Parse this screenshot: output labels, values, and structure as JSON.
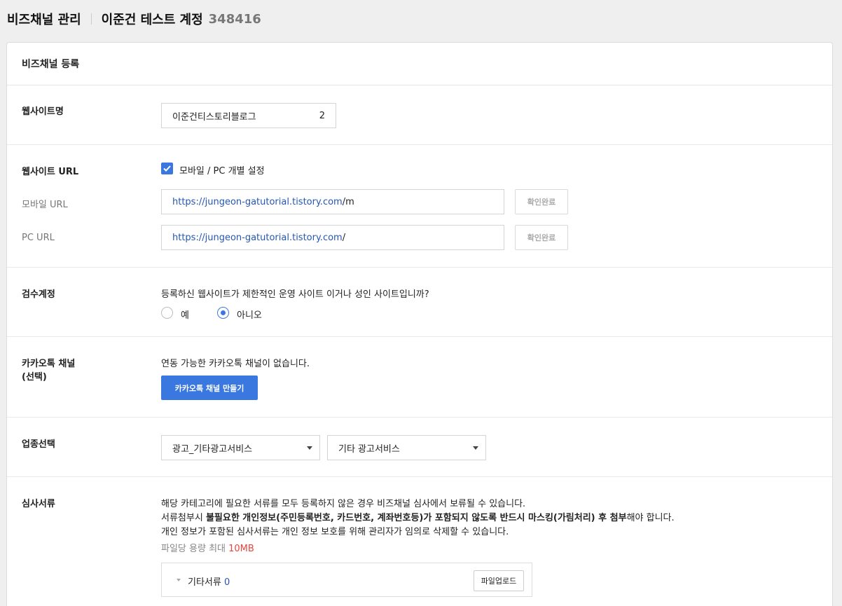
{
  "header": {
    "section_title": "비즈채널 관리",
    "account_name": "이준건 테스트 계정",
    "account_id": "348416"
  },
  "panel": {
    "title": "비즈채널 등록"
  },
  "website_name": {
    "label": "웹사이트명",
    "value": "이준건티스토리블로그",
    "char_count": "2"
  },
  "website_url": {
    "label": "웹사이트 URL",
    "checkbox_label": "모바일 / PC 개별 설정",
    "checkbox_checked": true,
    "mobile": {
      "label": "모바일 URL",
      "url_base": "https://jungeon-gatutorial.tistory.com",
      "url_path": "/m",
      "button": "확인완료"
    },
    "pc": {
      "label": "PC URL",
      "url_base": "https://jungeon-gatutorial.tistory.com",
      "url_path": "/",
      "button": "확인완료"
    }
  },
  "review_account": {
    "label": "검수계정",
    "question": "등록하신 웹사이트가 제한적인 운영 사이트 이거나 성인 사이트입니까?",
    "options": [
      "예",
      "아니오"
    ],
    "selected": "아니오"
  },
  "kakao_channel": {
    "label_line1": "카카오톡 채널",
    "label_line2": "(선택)",
    "message": "연동 가능한 카카오톡 채널이 없습니다.",
    "button": "카카오톡 채널 만들기"
  },
  "industry": {
    "label": "업종선택",
    "primary_selected": "광고_기타광고서비스",
    "secondary_selected": "기타 광고서비스"
  },
  "documents": {
    "label": "심사서류",
    "line1": "해당 카테고리에 필요한 서류를 모두 등록하지 않은 경우 비즈채널 심사에서 보류될 수 있습니다.",
    "line2_prefix": "서류첨부시 ",
    "line2_bold": "불필요한 개인정보(주민등록번호, 카드번호, 계좌번호등)가 포함되지 않도록 반드시 마스킹(가림처리) 후 첨부",
    "line2_suffix": "해야 합니다.",
    "line3": "개인 정보가 포함된 심사서류는 개인 정보 보호를 위해 관리자가 임의로 삭제할 수 있습니다.",
    "size_prefix": "파일당 용량 최대 ",
    "size_value": "10MB",
    "file_row_label": "기타서류",
    "file_row_count": "0",
    "upload_button": "파일업로드"
  },
  "colors": {
    "primary": "#3a78e0",
    "link": "#2456b4",
    "warning": "#e8453c"
  }
}
